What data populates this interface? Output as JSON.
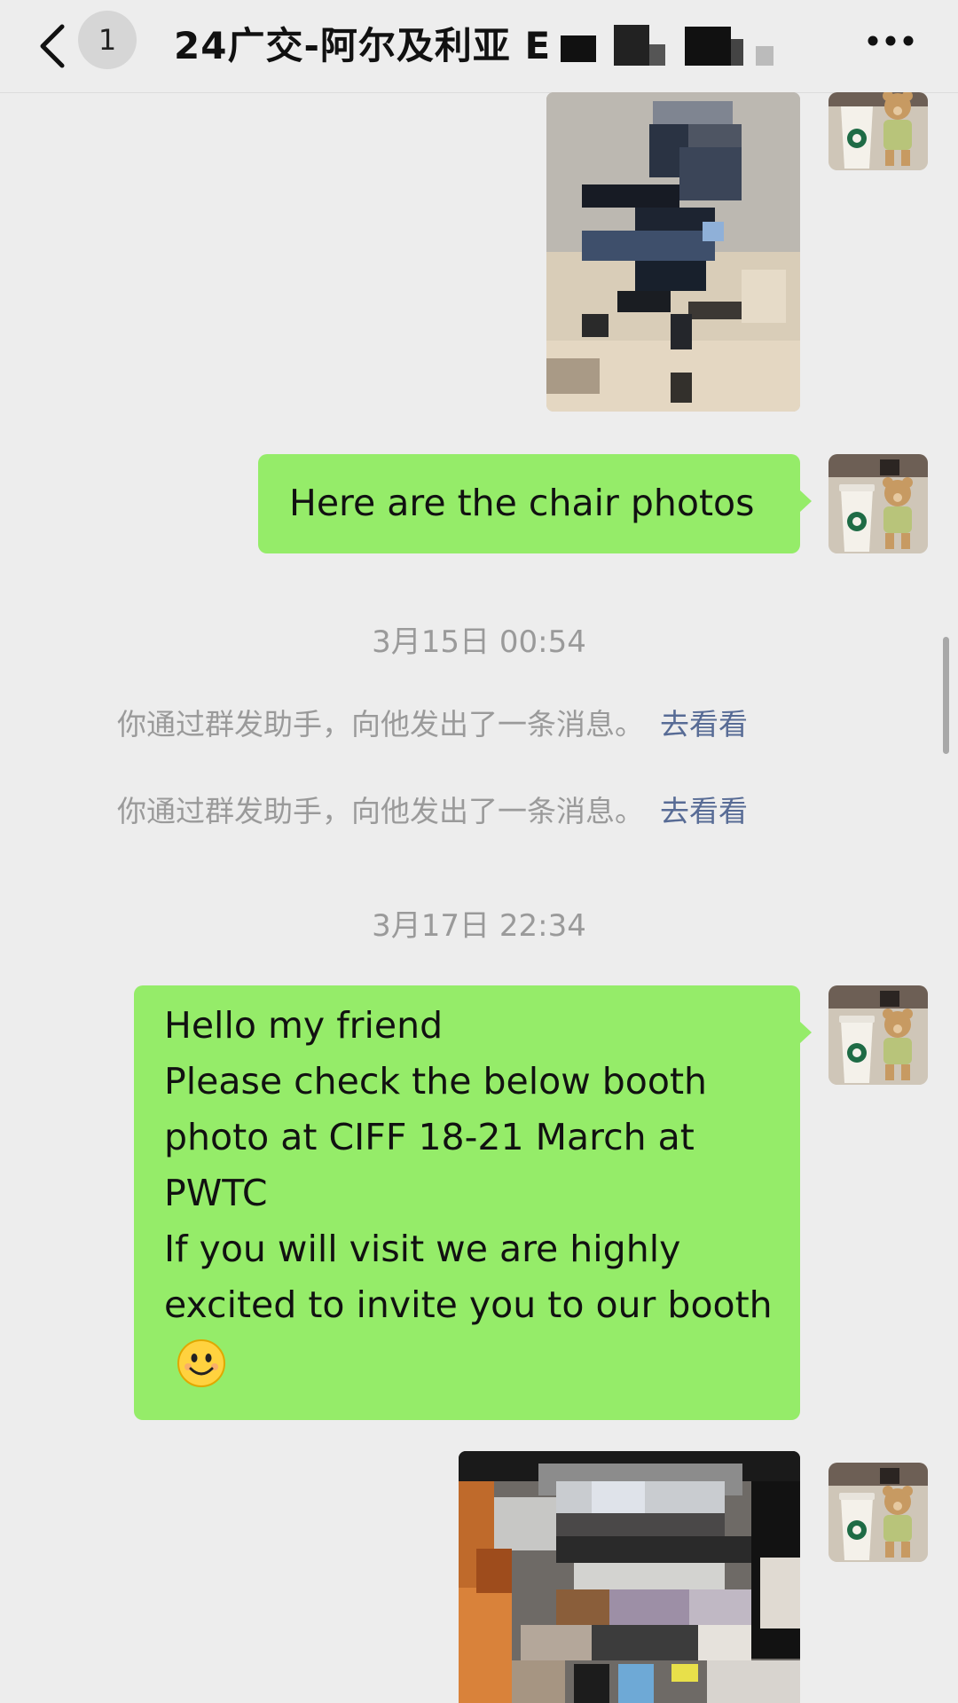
{
  "header": {
    "unread_count": "1",
    "title": "24广交-阿尔及利亚 E",
    "back_icon": "chevron-left-icon",
    "more_icon": "more-dots-icon"
  },
  "messages": [
    {
      "type": "image",
      "side": "right",
      "description_icon": "chair-photo"
    },
    {
      "type": "text",
      "side": "right",
      "lines": [
        "Here are the chair photos"
      ]
    },
    {
      "type": "timestamp",
      "text": "3月15日 00:54"
    },
    {
      "type": "system",
      "text": "你通过群发助手，向他发出了一条消息。",
      "link": "去看看"
    },
    {
      "type": "system",
      "text": "你通过群发助手，向他发出了一条消息。",
      "link": "去看看"
    },
    {
      "type": "timestamp",
      "text": "3月17日 22:34"
    },
    {
      "type": "text",
      "side": "right",
      "lines": [
        "Hello my friend",
        "Please check the below booth",
        "photo at CIFF 18-21 March at",
        "PWTC",
        "If you will visit we are highly",
        "excited to invite you to our booth"
      ],
      "emoji": "smile-emoji"
    },
    {
      "type": "image",
      "side": "right",
      "description_icon": "booth-photo"
    }
  ],
  "colors": {
    "background": "#ededed",
    "sent_bubble": "#95ec69",
    "system_text": "#9a9a9a",
    "link": "#576b95"
  }
}
